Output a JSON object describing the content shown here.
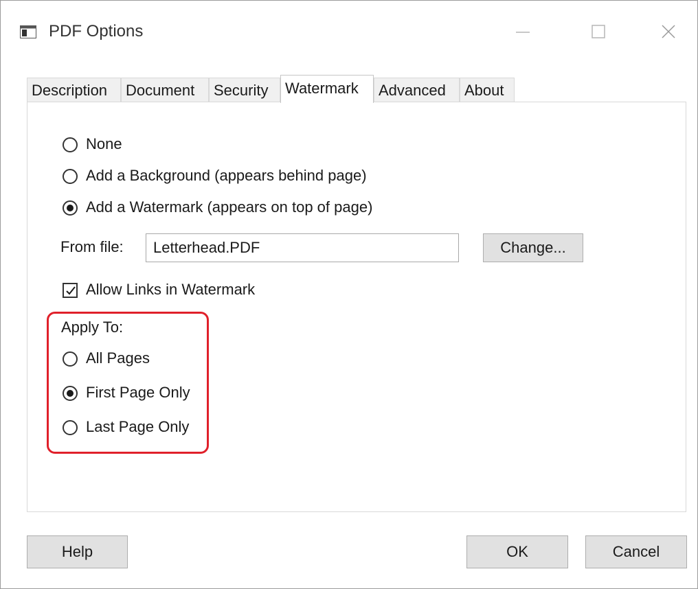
{
  "window": {
    "title": "PDF Options"
  },
  "tabs": [
    {
      "label": "Description",
      "active": false
    },
    {
      "label": "Document",
      "active": false
    },
    {
      "label": "Security",
      "active": false
    },
    {
      "label": "Watermark",
      "active": true
    },
    {
      "label": "Advanced",
      "active": false
    },
    {
      "label": "About",
      "active": false
    }
  ],
  "watermark": {
    "mode_options": [
      {
        "label": "None",
        "selected": false
      },
      {
        "label": "Add a Background (appears behind page)",
        "selected": false
      },
      {
        "label": "Add a Watermark (appears on top of page)",
        "selected": true
      }
    ],
    "from_file_label": "From file:",
    "from_file_value": "Letterhead.PDF",
    "change_button": "Change...",
    "allow_links_label": "Allow Links in Watermark",
    "allow_links_checked": true,
    "apply_to_label": "Apply To:",
    "apply_to_options": [
      {
        "label": "All Pages",
        "selected": false
      },
      {
        "label": "First Page Only",
        "selected": true
      },
      {
        "label": "Last Page Only",
        "selected": false
      }
    ]
  },
  "footer": {
    "help": "Help",
    "ok": "OK",
    "cancel": "Cancel"
  },
  "colors": {
    "highlight": "#e0202a"
  },
  "icons": {
    "app": "window-app-icon",
    "minimize": "minimize-icon",
    "maximize": "maximize-icon",
    "close": "close-icon"
  }
}
